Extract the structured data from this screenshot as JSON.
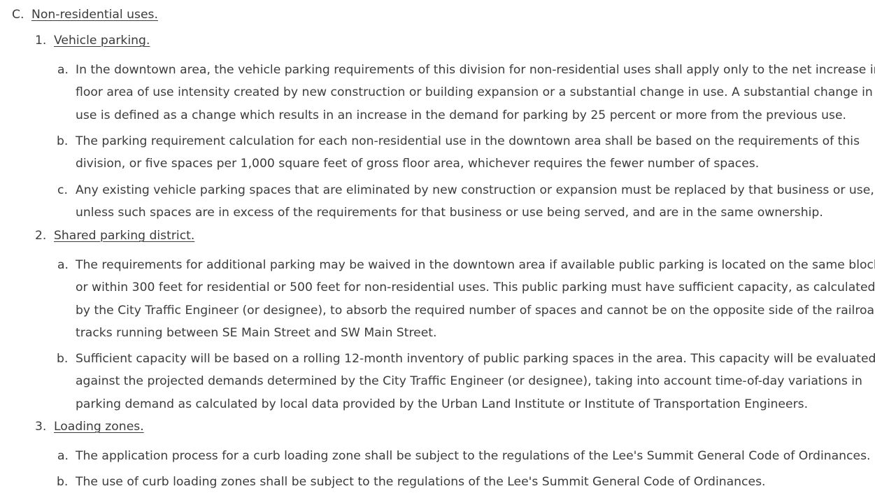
{
  "section": {
    "marker": "C.",
    "title": "Non-residential uses."
  },
  "items": [
    {
      "marker": "1.",
      "title": "Vehicle parking.",
      "subitems": [
        {
          "marker": "a.",
          "lines": [
            "In the downtown area, the vehicle parking requirements of this division for non-residential uses shall apply only to the net increase in",
            "floor area of use intensity created by new construction or building expansion or a substantial change in use. A substantial change in",
            "use is defined as a change which results in an increase in the demand for parking by 25 percent or more from the previous use."
          ]
        },
        {
          "marker": "b.",
          "lines": [
            "The parking requirement calculation for each non-residential use in the downtown area shall be based on the requirements of this",
            "division, or five spaces per 1,000 square feet of gross floor area, whichever requires the fewer number of spaces."
          ]
        },
        {
          "marker": "c.",
          "lines": [
            "Any existing vehicle parking spaces that are eliminated by new construction or expansion must be replaced by that business or use,",
            "unless such spaces are in excess of the requirements for that business or use being served, and are in the same ownership."
          ]
        }
      ]
    },
    {
      "marker": "2.",
      "title": "Shared parking district.",
      "subitems": [
        {
          "marker": "a.",
          "lines": [
            "The requirements for additional parking may be waived in the downtown area if available public parking is located on the same block",
            "or within 300 feet for residential or 500 feet for non-residential uses. This public parking must have sufficient capacity, as calculated",
            "by the City Traffic Engineer (or designee), to absorb the required number of spaces and cannot be on the opposite side of the railroad",
            "tracks running between SE Main Street and SW Main Street."
          ]
        },
        {
          "marker": "b.",
          "lines": [
            "Sufficient capacity will be based on a rolling 12-month inventory of public parking spaces in the area. This capacity will be evaluated",
            "against the projected demands determined by the City Traffic Engineer (or designee), taking into account time-of-day variations in",
            "parking demand as calculated by local data provided by the Urban Land Institute or Institute of Transportation Engineers."
          ]
        }
      ]
    },
    {
      "marker": "3.",
      "title": "Loading zones.",
      "subitems": [
        {
          "marker": "a.",
          "lines": [
            "The application process for a curb loading zone shall be subject to the regulations of the Lee's Summit General Code of Ordinances."
          ]
        },
        {
          "marker": "b.",
          "lines": [
            "The use of curb loading zones shall be subject to the regulations of the Lee's Summit General Code of Ordinances."
          ]
        }
      ]
    }
  ]
}
